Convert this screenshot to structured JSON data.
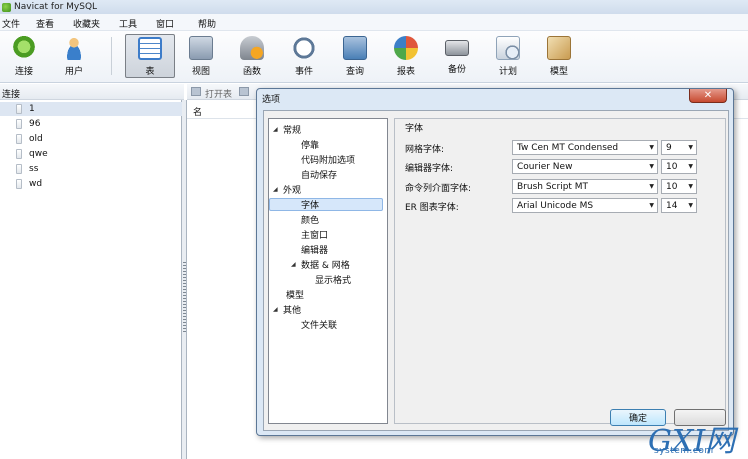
{
  "window": {
    "title": "Navicat for MySQL"
  },
  "menu": [
    "文件",
    "查看",
    "收藏夹",
    "工具",
    "窗口",
    "帮助"
  ],
  "toolbar": [
    {
      "label": "连接",
      "icon": "connection-icon",
      "color": "#6fbf3a"
    },
    {
      "label": "用户",
      "icon": "user-icon",
      "color": "#e8a33b"
    },
    {
      "label": "表",
      "icon": "table-icon",
      "color": "#3d7cc9",
      "active": true
    },
    {
      "label": "视图",
      "icon": "view-icon",
      "color": "#7a8da3"
    },
    {
      "label": "函数",
      "icon": "function-icon",
      "color": "#f0a020"
    },
    {
      "label": "事件",
      "icon": "event-icon",
      "color": "#5d7897"
    },
    {
      "label": "查询",
      "icon": "query-icon",
      "color": "#4a7fb6"
    },
    {
      "label": "报表",
      "icon": "report-icon",
      "color": "#e0573c"
    },
    {
      "label": "备份",
      "icon": "backup-icon",
      "color": "#5a5f66"
    },
    {
      "label": "计划",
      "icon": "schedule-icon",
      "color": "#8fa3b8"
    },
    {
      "label": "模型",
      "icon": "model-icon",
      "color": "#c99b50"
    }
  ],
  "left": {
    "header": "连接",
    "connections": [
      "1",
      "96",
      "old",
      "qwe",
      "ss",
      "wd"
    ]
  },
  "objtoolbar": {
    "open": "打开表"
  },
  "list": {
    "header": "名"
  },
  "dialog": {
    "title": "选项",
    "close": "✕",
    "tree": [
      {
        "label": "常规",
        "level": 0,
        "expanded": true
      },
      {
        "label": "停靠",
        "level": 1
      },
      {
        "label": "代码附加选项",
        "level": 1
      },
      {
        "label": "自动保存",
        "level": 1
      },
      {
        "label": "外观",
        "level": 0,
        "expanded": true
      },
      {
        "label": "字体",
        "level": 1,
        "selected": true
      },
      {
        "label": "颜色",
        "level": 1
      },
      {
        "label": "主窗口",
        "level": 1
      },
      {
        "label": "编辑器",
        "level": 1
      },
      {
        "label": "数据 & 网格",
        "level": 1,
        "expanded": true
      },
      {
        "label": "显示格式",
        "level": 2
      },
      {
        "label": "模型",
        "level": 0
      },
      {
        "label": "其他",
        "level": 0,
        "expanded": true
      },
      {
        "label": "文件关联",
        "level": 1
      }
    ],
    "fonts": {
      "title": "字体",
      "rows": [
        {
          "label": "网格字体:",
          "font": "Tw Cen MT Condensed",
          "size": "9"
        },
        {
          "label": "编辑器字体:",
          "font": "Courier New",
          "size": "10"
        },
        {
          "label": "命令列介面字体:",
          "font": "Brush Script MT",
          "size": "10"
        },
        {
          "label": "ER 图表字体:",
          "font": "Arial Unicode MS",
          "size": "14"
        }
      ]
    },
    "ok": "确定"
  },
  "watermark": {
    "big": "GXI网",
    "small": "system.com"
  }
}
